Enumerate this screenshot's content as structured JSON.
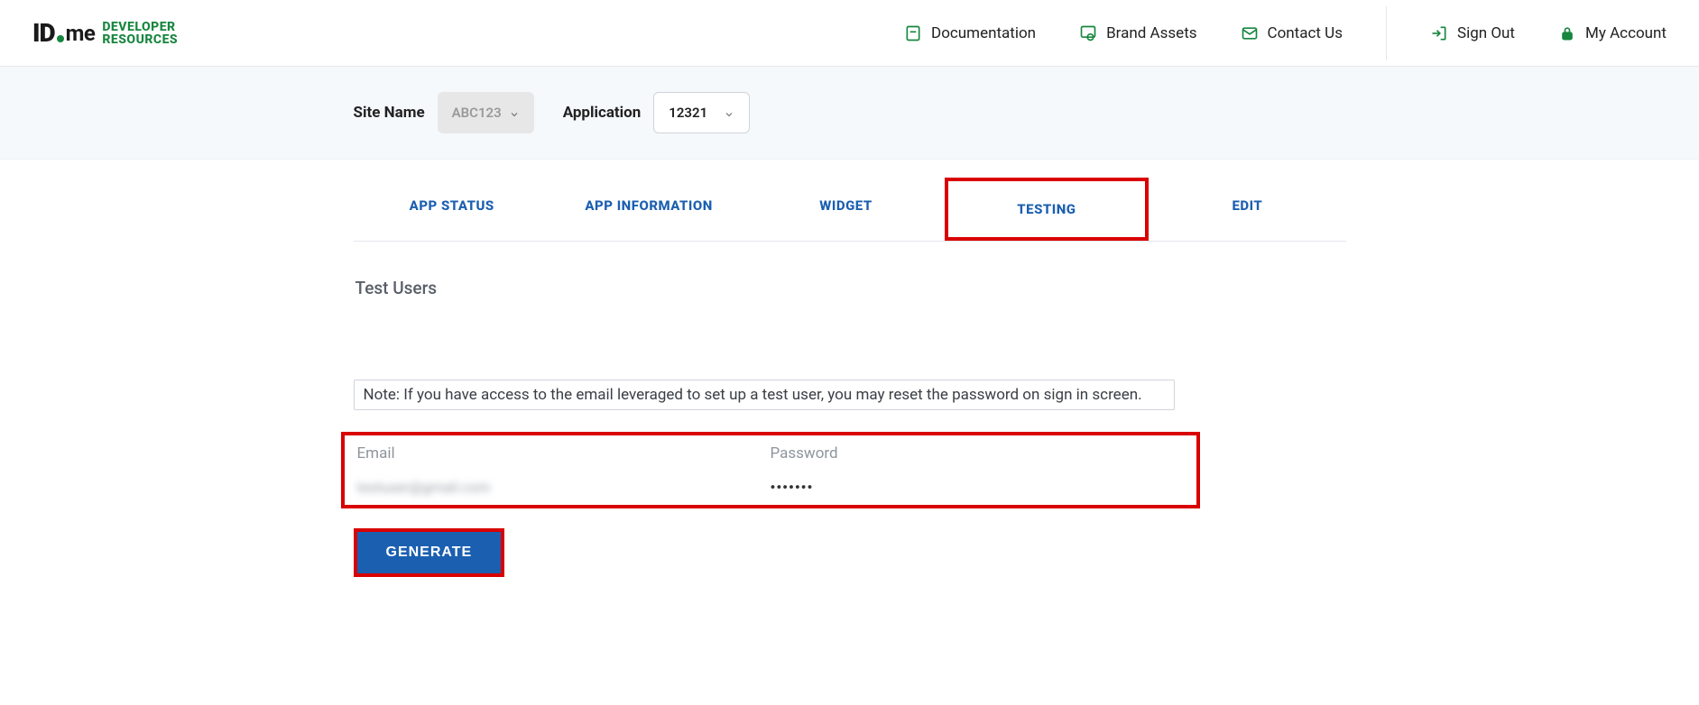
{
  "logo": {
    "id": "ID",
    "me": "me",
    "line1": "DEVELOPER",
    "line2": "RESOURCES"
  },
  "nav": {
    "documentation": "Documentation",
    "brand_assets": "Brand Assets",
    "contact_us": "Contact Us",
    "sign_out": "Sign Out",
    "my_account": "My Account"
  },
  "subheader": {
    "site_label": "Site Name",
    "site_value": "ABC123",
    "app_label": "Application",
    "app_value": "12321"
  },
  "tabs": {
    "app_status": "APP STATUS",
    "app_information": "APP INFORMATION",
    "widget": "WIDGET",
    "testing": "TESTING",
    "edit": "EDIT"
  },
  "testing": {
    "section_title": "Test Users",
    "note": "Note: If you have access to the email leveraged to set up a test user, you may reset the password on sign in screen.",
    "email_label": "Email",
    "email_value": "testuser@gmail.com",
    "password_label": "Password",
    "password_value": "•••••••",
    "generate": "GENERATE"
  }
}
